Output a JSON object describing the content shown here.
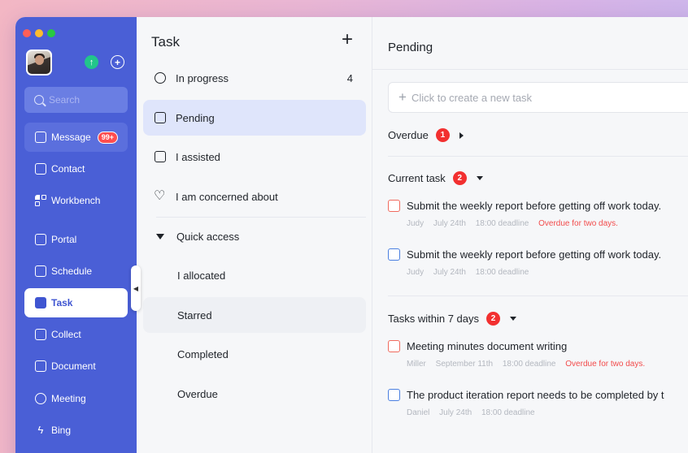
{
  "sidebar": {
    "search_placeholder": "Search",
    "message_badge": "99+",
    "items": [
      {
        "label": "Message"
      },
      {
        "label": "Contact"
      },
      {
        "label": "Workbench"
      },
      {
        "label": "Portal"
      },
      {
        "label": "Schedule"
      },
      {
        "label": "Task"
      },
      {
        "label": "Collect"
      },
      {
        "label": "Document"
      },
      {
        "label": "Meeting"
      },
      {
        "label": "Bing"
      }
    ]
  },
  "task_panel": {
    "title": "Task",
    "add_icon": "+",
    "items": [
      {
        "label": "In progress",
        "count": "4"
      },
      {
        "label": "Pending"
      },
      {
        "label": "I assisted"
      },
      {
        "label": "I am concerned about"
      }
    ],
    "quick_access": {
      "label": "Quick access",
      "items": [
        {
          "label": "I allocated"
        },
        {
          "label": "Starred"
        },
        {
          "label": "Completed"
        },
        {
          "label": "Overdue"
        }
      ]
    }
  },
  "pending": {
    "title": "Pending",
    "new_task_placeholder": "Click to create a new task",
    "sections": [
      {
        "label": "Overdue",
        "count": "1"
      },
      {
        "label": "Current task",
        "count": "2"
      },
      {
        "label": "Tasks within 7 days",
        "count": "2"
      }
    ],
    "tasks": [
      {
        "title": "Submit the weekly report before getting off work today.",
        "assignee": "Judy",
        "date": "July 24th",
        "deadline": "18:00 deadline",
        "status": "Overdue for two days."
      },
      {
        "title": "Submit the weekly report before getting off work today.",
        "assignee": "Judy",
        "date": "July 24th",
        "deadline": "18:00 deadline"
      },
      {
        "title": "Meeting minutes document writing",
        "assignee": "Miller",
        "date": "September 11th",
        "deadline": "18:00 deadline",
        "status": "Overdue for two days."
      },
      {
        "title": "The product iteration report needs to be completed by t",
        "assignee": "Daniel",
        "date": "July 24th",
        "deadline": "18:00 deadline"
      }
    ]
  },
  "colors": {
    "sidebar": "#4a5fd6",
    "accent": "#3f55d1",
    "overdue": "#f24b4b",
    "badge": "#f23030"
  }
}
